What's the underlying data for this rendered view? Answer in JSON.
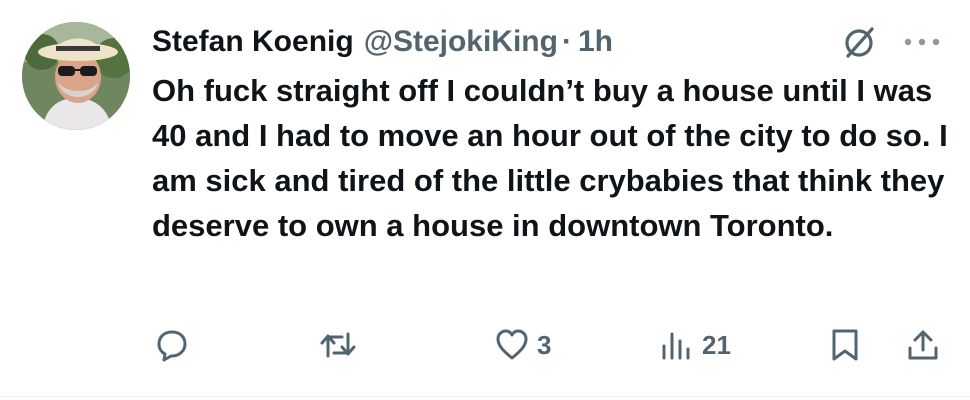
{
  "tweet": {
    "author_name": "Stefan Koenig",
    "handle": "@StejokiKing",
    "separator": "·",
    "time": "1h",
    "text": "Oh fuck straight off I couldn’t buy a house until I was 40 and I had to move an hour out of the city to do so. I am sick and tired of the little crybabies that think they deserve to own a house in downtown Toronto."
  },
  "actions": {
    "reply_icon": "reply-icon",
    "retweet_icon": "retweet-icon",
    "like_icon": "heart-icon",
    "like_count": "3",
    "views_icon": "views-icon",
    "views_count": "21",
    "bookmark_icon": "bookmark-icon",
    "share_icon": "share-icon"
  },
  "colors": {
    "text": "#0f1419",
    "secondary": "#536471",
    "background": "#ffffff"
  }
}
